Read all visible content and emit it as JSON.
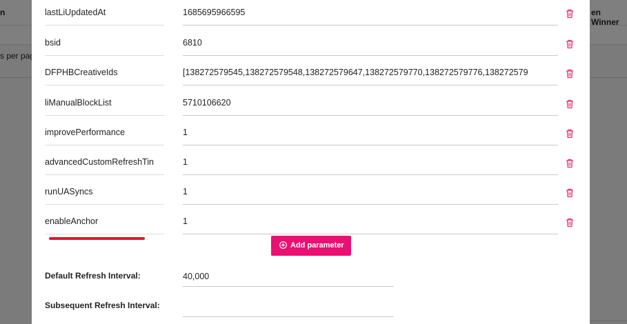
{
  "background": {
    "header_left": "n",
    "header_right": "en Winner",
    "rows_per_page": "s per pag"
  },
  "params": [
    {
      "key": "lastLiUpdatedAt",
      "value": "1685695966595"
    },
    {
      "key": "bsid",
      "value": "6810"
    },
    {
      "key": "DFPHBCreativeIds",
      "value": "[138272579545,138272579548,138272579647,138272579770,138272579776,138272579"
    },
    {
      "key": "liManualBlockList",
      "value": "5710106620"
    },
    {
      "key": "improvePerformance",
      "value": "1"
    },
    {
      "key": "advancedCustomRefreshTin",
      "value": "1"
    },
    {
      "key": "runUASyncs",
      "value": "1"
    },
    {
      "key": "enableAnchor",
      "value": "1"
    }
  ],
  "add_parameter_label": "Add parameter",
  "default_refresh": {
    "label": "Default Refresh Interval:",
    "value": "40,000"
  },
  "subsequent_refresh": {
    "label": "Subsequent Refresh Interval:",
    "value": ""
  },
  "colors": {
    "accent": "#ea1072",
    "trash": "#e8306e",
    "annotation": "#d81b2c"
  }
}
